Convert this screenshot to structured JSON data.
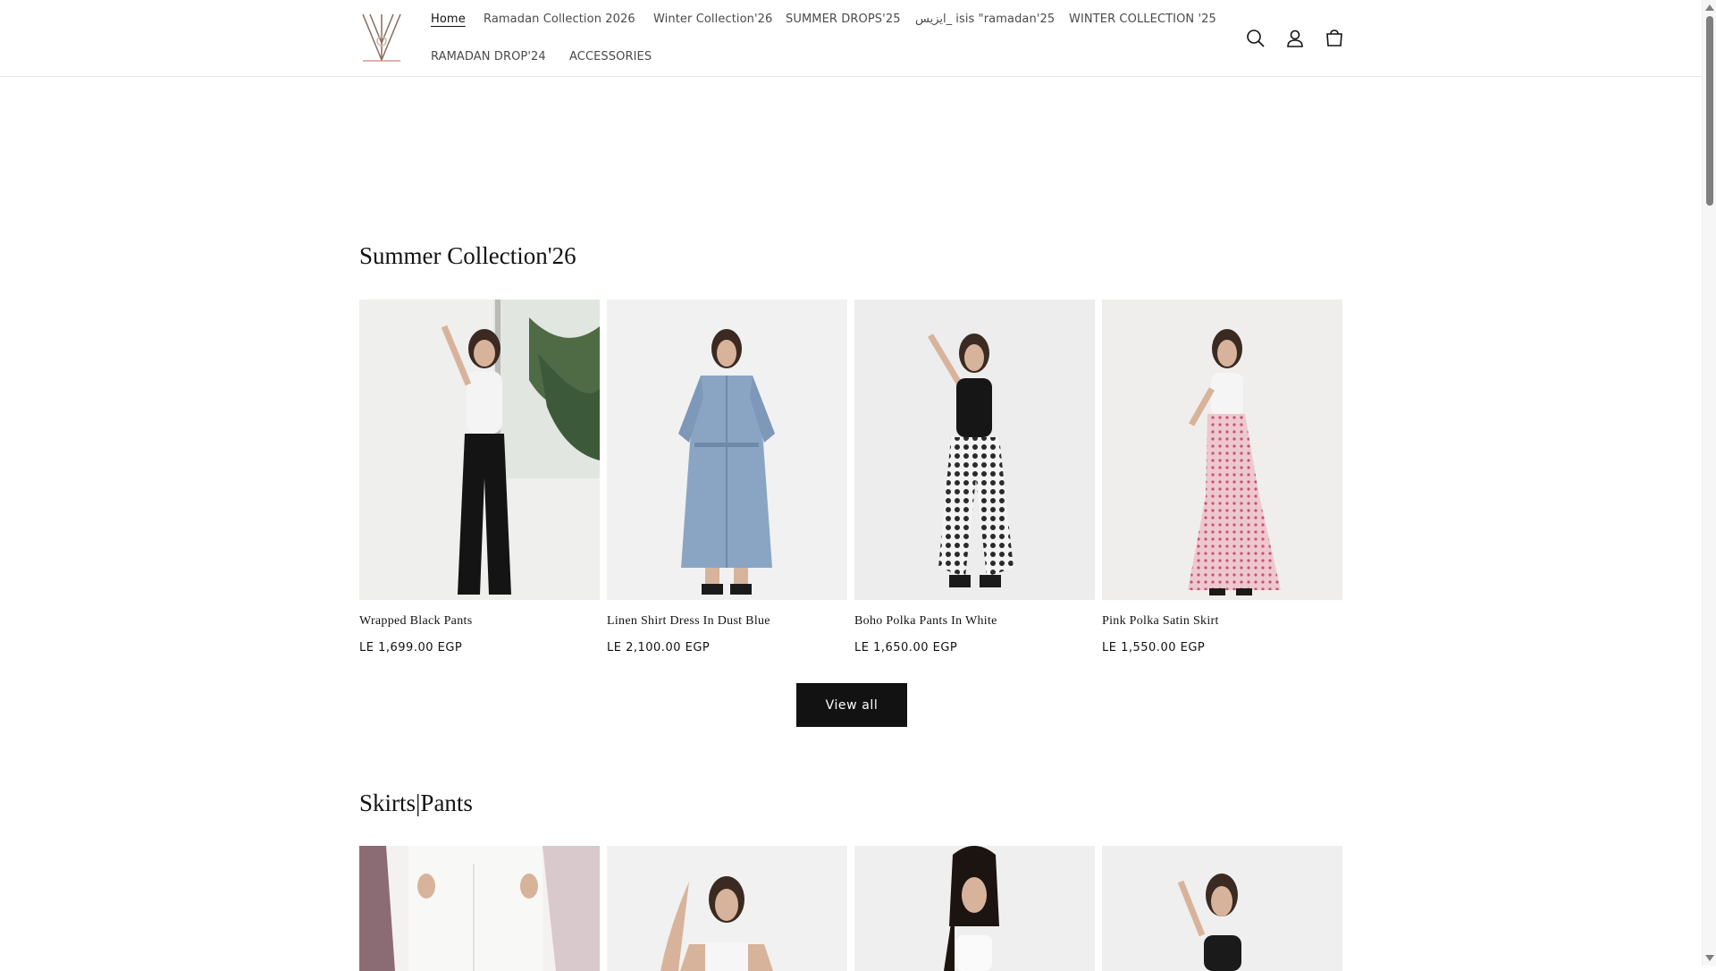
{
  "nav": {
    "items": [
      {
        "label": "Home"
      },
      {
        "label": "Ramadan Collection 2026"
      },
      {
        "label": "Winter Collection'26"
      },
      {
        "label": "SUMMER DROPS'25"
      },
      {
        "label": "ايزيس_ isis \"ramadan'25"
      },
      {
        "label": "WINTER COLLECTION '25"
      },
      {
        "label": "RAMADAN DROP'24"
      },
      {
        "label": "ACCESSORIES"
      }
    ],
    "icons": [
      "search-icon",
      "account-icon",
      "cart-icon"
    ]
  },
  "sections": [
    {
      "title": "Summer Collection'26",
      "products": [
        {
          "name": "Wrapped Black Pants",
          "price": "LE 1,699.00 EGP"
        },
        {
          "name": "Linen Shirt Dress In Dust Blue",
          "price": "LE 2,100.00 EGP"
        },
        {
          "name": "Boho Polka Pants In White",
          "price": "LE 1,650.00 EGP"
        },
        {
          "name": "Pink Polka Satin Skirt",
          "price": "LE 1,550.00 EGP"
        }
      ],
      "view_all_label": "View all"
    },
    {
      "title": "Skirts|Pants"
    }
  ],
  "colors": {
    "accent": "#121212",
    "background": "#ffffff",
    "nav_text": "#4a4a4a"
  }
}
